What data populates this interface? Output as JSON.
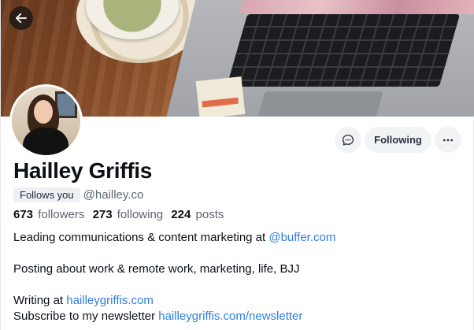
{
  "profile": {
    "name": "Hailley Griffis",
    "follows_you": "Follows you",
    "handle": "@hailley.co",
    "action_following": "Following",
    "stats": {
      "followers_count": "673",
      "followers_label": "followers",
      "following_count": "273",
      "following_label": "following",
      "posts_count": "224",
      "posts_label": "posts"
    },
    "bio": {
      "line1_text": "Leading communications & content marketing at ",
      "line1_link": "@buffer.com",
      "line2": "Posting about work & remote work, marketing, life, BJJ",
      "line3_text": "Writing at ",
      "line3_link": "hailleygriffis.com",
      "line4_text": "Subscribe to my newsletter ",
      "line4_link": "hailleygriffis.com/newsletter"
    }
  },
  "icons": {
    "back": "arrow-left-icon",
    "message": "chat-bubble-icon",
    "more": "ellipsis-icon"
  },
  "colors": {
    "link": "#2f7de1",
    "button_bg": "#f1f3f5",
    "secondary_text": "#5b6673"
  }
}
